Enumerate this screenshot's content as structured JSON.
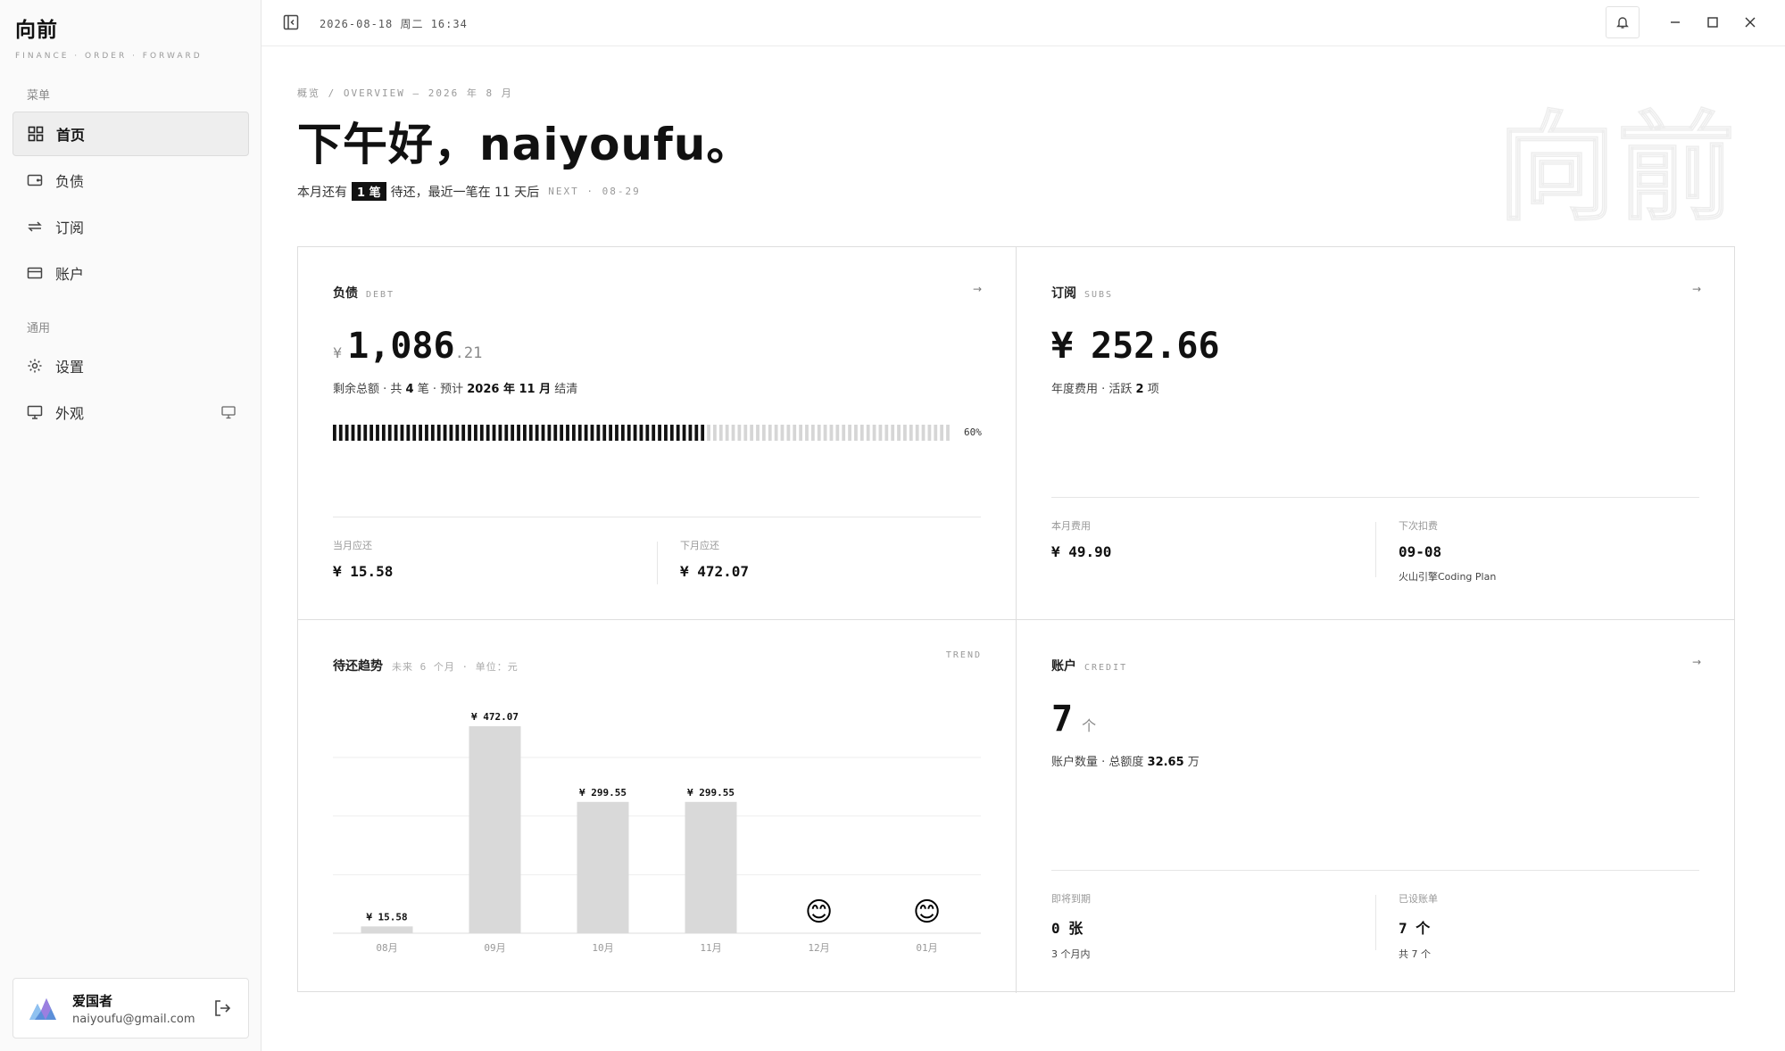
{
  "app": {
    "title": "向前",
    "subtitle": "FINANCE · ORDER · FORWARD"
  },
  "sidebar": {
    "menu_label": "菜单",
    "general_label": "通用",
    "items": [
      {
        "label": "首页",
        "icon": "grid-icon"
      },
      {
        "label": "负债",
        "icon": "wallet-icon"
      },
      {
        "label": "订阅",
        "icon": "repeat-icon"
      },
      {
        "label": "账户",
        "icon": "card-icon"
      },
      {
        "label": "设置",
        "icon": "gear-icon"
      },
      {
        "label": "外观",
        "icon": "monitor-icon"
      }
    ]
  },
  "user": {
    "name": "爱国者",
    "email": "naiyoufu@gmail.com"
  },
  "topbar": {
    "datetime": "2026-08-18 周二 16:34"
  },
  "header": {
    "breadcrumb": "概览 / OVERVIEW — 2026 年 8 月",
    "greeting": "下午好，naiyoufu。",
    "sub_pre": "本月还有",
    "sub_badge": "1 笔",
    "sub_post": "待还，最近一笔在 11 天后",
    "next_hint": "NEXT · 08-29",
    "watermark": "向前"
  },
  "debt": {
    "title": "负债",
    "tag": "DEBT",
    "currency": "¥",
    "amount_int": "1,086",
    "amount_dec": ".21",
    "desc_pre": "剩余总额 · 共 ",
    "desc_count": "4",
    "desc_mid": " 笔 · 预计 ",
    "desc_date": "2026 年 11 月",
    "desc_post": " 结清",
    "progress": 60,
    "progress_label": "60%",
    "this_month_label": "当月应还",
    "this_month_value": "¥ 15.58",
    "next_month_label": "下月应还",
    "next_month_value": "¥ 472.07"
  },
  "subs": {
    "title": "订阅",
    "tag": "SUBS",
    "currency": "¥",
    "amount": "252.66",
    "desc_pre": "年度费用 · 活跃 ",
    "desc_count": "2",
    "desc_post": " 项",
    "month_label": "本月费用",
    "month_value": "¥ 49.90",
    "next_label": "下次扣费",
    "next_value": "09-08",
    "next_sub": "火山引擎Coding Plan"
  },
  "trend": {
    "title": "待还趋势",
    "subtitle": "未来 6 个月 · 单位：元",
    "tag": "TREND"
  },
  "accounts": {
    "title": "账户",
    "tag": "CREDIT",
    "count": "7",
    "unit": "个",
    "desc_pre": "账户数量 · 总额度 ",
    "desc_value": "32.65",
    "desc_post": " 万",
    "expiring_label": "即将到期",
    "expiring_value": "0 张",
    "expiring_sub": "3 个月内",
    "bill_label": "已设账单",
    "bill_value": "7 个",
    "bill_sub": "共 7 个"
  },
  "colors": {
    "accent": "#111111",
    "bar": "#d9d9d9",
    "muted": "#999999"
  },
  "chart_data": {
    "type": "bar",
    "categories": [
      "08月",
      "09月",
      "10月",
      "11月",
      "12月",
      "01月"
    ],
    "values": [
      15.58,
      472.07,
      299.55,
      299.55,
      0,
      0
    ],
    "labels": [
      "¥ 15.58",
      "¥ 472.07",
      "¥ 299.55",
      "¥ 299.55",
      "",
      ""
    ],
    "empty_marker": "😊",
    "ylim": [
      0,
      472.07
    ],
    "grid": true
  }
}
